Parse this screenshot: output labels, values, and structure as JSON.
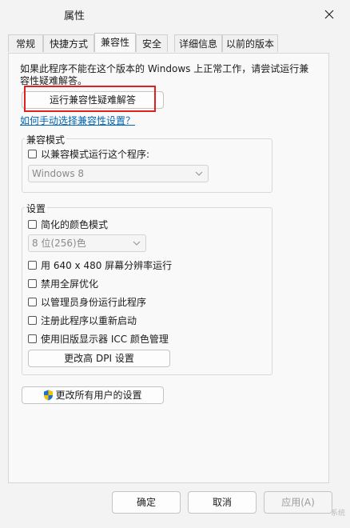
{
  "window": {
    "title": "属性"
  },
  "tabs": [
    "常规",
    "快捷方式",
    "兼容性",
    "安全",
    "详细信息",
    "以前的版本"
  ],
  "active_tab": "兼容性",
  "intro_text": "如果此程序不能在这个版本的 Windows 上正常工作，请尝试运行兼容性疑难解答。",
  "troubleshoot_button": "运行兼容性疑难解答",
  "manual_link": "如何手动选择兼容性设置？",
  "compat_mode": {
    "group_label": "兼容模式",
    "checkbox_label": "以兼容模式运行这个程序:",
    "selected_os": "Windows 8"
  },
  "settings": {
    "group_label": "设置",
    "reduced_color": "简化的颜色模式",
    "color_depth": "8 位(256)色",
    "run_640": "用 640 x 480 屏幕分辨率运行",
    "disable_fullscreen": "禁用全屏优化",
    "run_admin": "以管理员身份运行此程序",
    "register_restart": "注册此程序以重新启动",
    "legacy_icc": "使用旧版显示器 ICC 颜色管理",
    "dpi_button": "更改高 DPI 设置"
  },
  "all_users_button": "更改所有用户的设置",
  "footer": {
    "ok": "确定",
    "cancel": "取消",
    "apply": "应用(A)"
  },
  "watermark": "系统"
}
